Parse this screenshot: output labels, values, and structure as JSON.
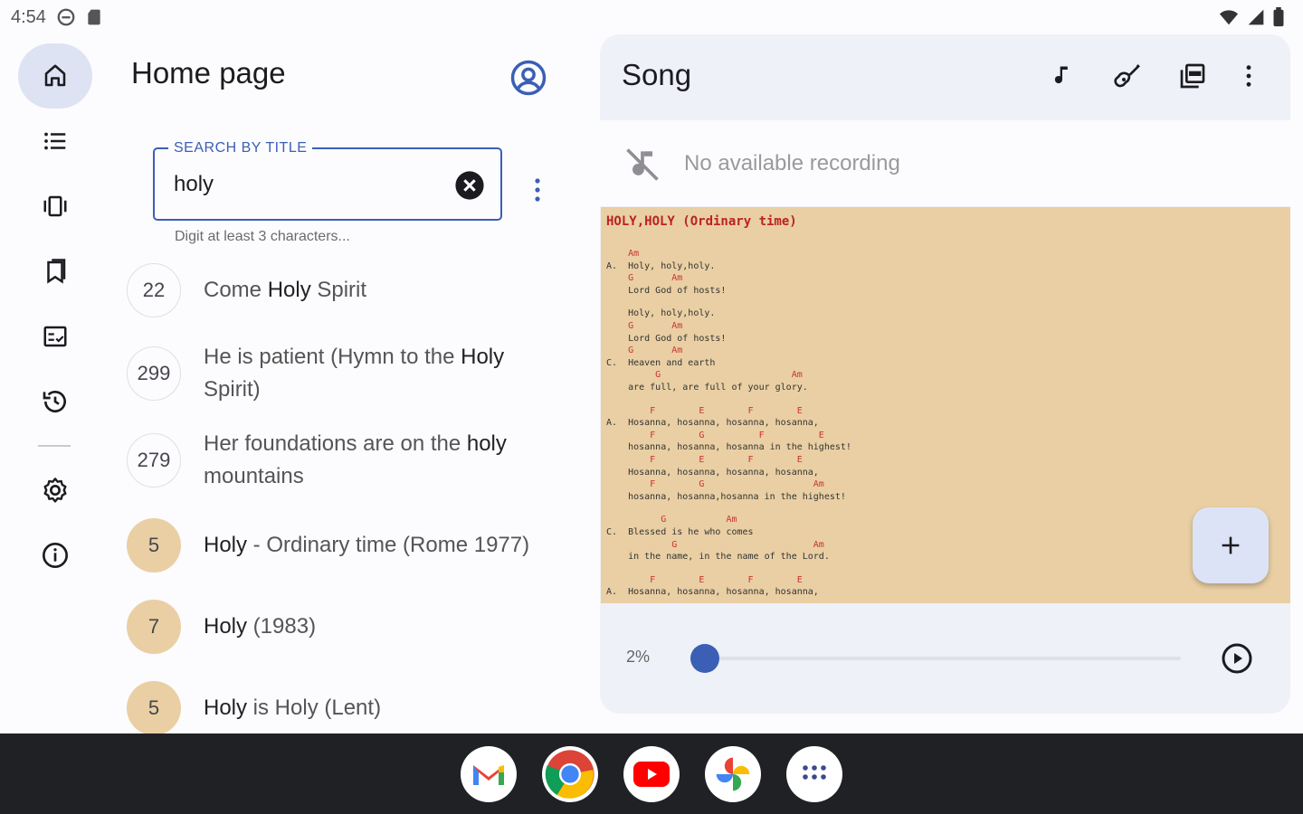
{
  "status": {
    "time": "4:54"
  },
  "nav": {
    "items": [
      {
        "name": "home"
      },
      {
        "name": "list"
      },
      {
        "name": "carousel"
      },
      {
        "name": "bookmarks"
      },
      {
        "name": "checklist"
      },
      {
        "name": "history"
      },
      {
        "name": "settings"
      },
      {
        "name": "info"
      }
    ]
  },
  "left": {
    "title": "Home page",
    "search": {
      "label": "SEARCH BY TITLE",
      "value": "holy",
      "helper": "Digit at least 3 characters..."
    },
    "songs": [
      {
        "number": "22",
        "pre": "Come ",
        "match": "Holy",
        "post": " Spirit",
        "style": "outline"
      },
      {
        "number": "299",
        "pre": "He is patient (Hymn to the ",
        "match": "Holy",
        "post": " Spirit)",
        "style": "outline"
      },
      {
        "number": "279",
        "pre": "Her foundations are on the ",
        "match": "holy",
        "post": " mountains",
        "style": "outline"
      },
      {
        "number": "5",
        "pre": "",
        "match": "Holy",
        "post": " - Ordinary time (Rome 1977)",
        "style": "filled"
      },
      {
        "number": "7",
        "pre": "",
        "match": "Holy",
        "post": " (1983)",
        "style": "filled"
      },
      {
        "number": "5",
        "pre": "",
        "match": "Holy",
        "post": " is Holy (Lent)",
        "style": "filled"
      }
    ]
  },
  "right": {
    "title": "Song",
    "recording": "No available recording",
    "sheet": {
      "title": "HOLY,HOLY (Ordinary time)",
      "lines": [
        {
          "text": "    Am",
          "chord": true
        },
        {
          "text": "A.  Holy, holy,holy.",
          "chord": false
        },
        {
          "text": "    G       Am",
          "chord": true
        },
        {
          "text": "    Lord God of hosts!",
          "chord": false
        },
        {
          "text": "",
          "chord": false
        },
        {
          "text": "    Holy, holy,holy.",
          "chord": false
        },
        {
          "text": "    G       Am",
          "chord": true
        },
        {
          "text": "    Lord God of hosts!",
          "chord": false
        },
        {
          "text": "    G       Am",
          "chord": true
        },
        {
          "text": "C.  Heaven and earth",
          "chord": false
        },
        {
          "text": "         G                        Am",
          "chord": true
        },
        {
          "text": "    are full, are full of your glory.",
          "chord": false
        },
        {
          "text": "",
          "chord": false
        },
        {
          "text": "        F        E        F        E",
          "chord": true
        },
        {
          "text": "A.  Hosanna, hosanna, hosanna, hosanna,",
          "chord": false
        },
        {
          "text": "        F        G          F          E",
          "chord": true
        },
        {
          "text": "    hosanna, hosanna, hosanna in the highest!",
          "chord": false
        },
        {
          "text": "        F        E        F        E",
          "chord": true
        },
        {
          "text": "    Hosanna, hosanna, hosanna, hosanna,",
          "chord": false
        },
        {
          "text": "        F        G                    Am",
          "chord": true
        },
        {
          "text": "    hosanna, hosanna,hosanna in the highest!",
          "chord": false
        },
        {
          "text": "",
          "chord": false
        },
        {
          "text": "          G           Am",
          "chord": true
        },
        {
          "text": "C.  Blessed is he who comes",
          "chord": false
        },
        {
          "text": "            G                         Am",
          "chord": true
        },
        {
          "text": "    in the name, in the name of the Lord.",
          "chord": false
        },
        {
          "text": "",
          "chord": false
        },
        {
          "text": "        F        E        F        E",
          "chord": true
        },
        {
          "text": "A.  Hosanna, hosanna, hosanna, hosanna,",
          "chord": false
        }
      ]
    },
    "speed": "2%",
    "speed_value": 0.02
  },
  "dock": [
    "Gmail",
    "Chrome",
    "YouTube",
    "Photos",
    "Apps"
  ],
  "colors": {
    "accent": "#3b5fb5",
    "sheet_bg": "#e9cfa3",
    "chord": "#cc3333"
  }
}
